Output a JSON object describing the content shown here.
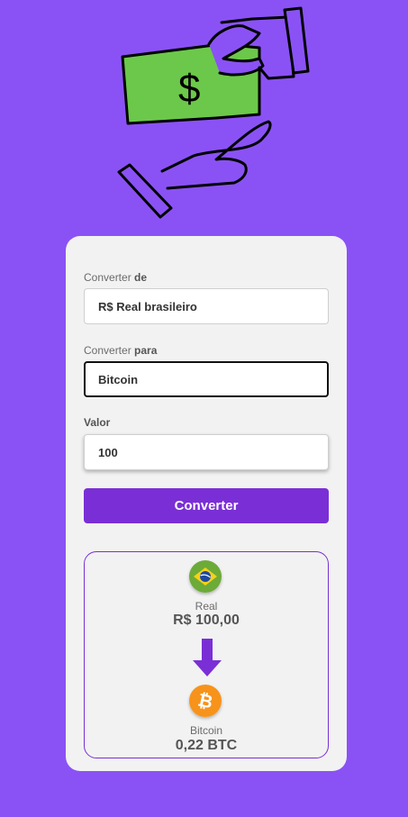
{
  "form": {
    "from_label_prefix": "Converter",
    "from_label_bold": "de",
    "from_value": "R$ Real brasileiro",
    "to_label_prefix": "Converter",
    "to_label_bold": "para",
    "to_value": "Bitcoin",
    "amount_label": "Valor",
    "amount_value": "100",
    "convert_button": "Converter"
  },
  "result": {
    "from_currency_name": "Real",
    "from_currency_value": "R$ 100,00",
    "to_currency_name": "Bitcoin",
    "to_currency_value": "0,22 BTC"
  },
  "icons": {
    "hero": "money-hand-illustration",
    "from_flag": "brazil-flag-icon",
    "arrow": "arrow-down-icon",
    "to_flag": "bitcoin-icon"
  },
  "colors": {
    "background": "#8a52f5",
    "accent": "#7a2fd6",
    "card": "#f2f2f2",
    "money": "#6cc84a",
    "bitcoin": "#f7931a"
  }
}
